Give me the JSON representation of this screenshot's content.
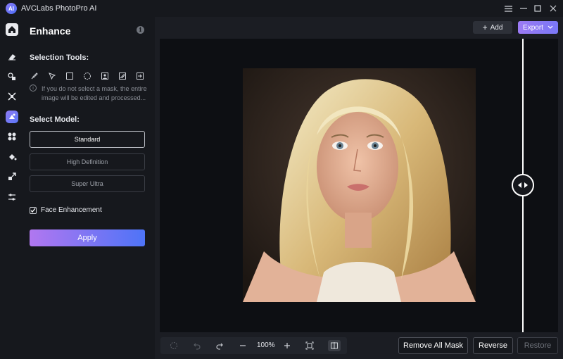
{
  "app": {
    "title": "AVCLabs PhotoPro AI",
    "logo_text": "AI",
    "window_controls": [
      "menu-icon",
      "minimize-icon",
      "maximize-icon",
      "close-icon"
    ]
  },
  "rail": {
    "items": [
      "home-icon",
      "eraser-icon",
      "shapes-icon",
      "expand-icon",
      "enhance-icon",
      "fan-icon",
      "paint-bucket-icon",
      "resize-icon",
      "sliders-icon"
    ],
    "active": "enhance-icon"
  },
  "panel": {
    "title": "Enhance",
    "selection_tools_label": "Selection Tools:",
    "tools": [
      "brush-icon",
      "pointer-icon",
      "rectangle-icon",
      "ellipse-icon",
      "portrait-icon",
      "pattern-icon",
      "import-icon"
    ],
    "hint": "If you do not select a mask, the entire image will be edited and processed...",
    "select_model_label": "Select Model:",
    "models": [
      "Standard",
      "High Definition",
      "Super Ultra"
    ],
    "selected_model": "Standard",
    "face_enhancement_label": "Face Enhancement",
    "face_enhancement_checked": true,
    "apply_label": "Apply"
  },
  "toolbar": {
    "add_label": "Add",
    "export_label": "Export"
  },
  "bottom": {
    "zoom": "100%",
    "remove_all_mask_label": "Remove All Mask",
    "reverse_label": "Reverse",
    "restore_label": "Restore"
  },
  "colors": {
    "accent_purple": "#9c7af4",
    "accent_blue": "#4e74f7",
    "background": "#16181d"
  }
}
